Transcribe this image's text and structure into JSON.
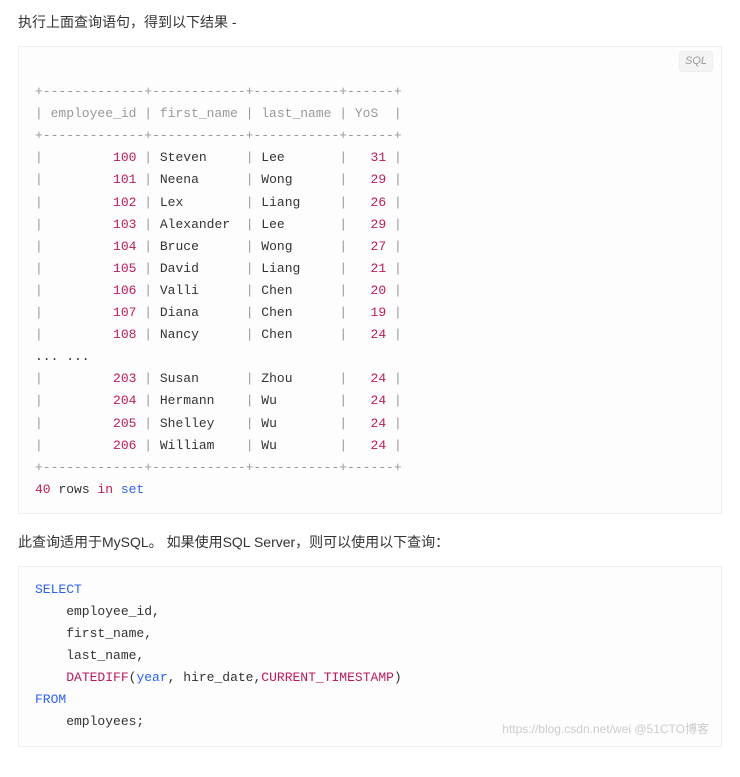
{
  "intro_text": "执行上面查询语句，得到以下结果 -",
  "lang_badge": "SQL",
  "table": {
    "border": "+-------------+------------+-----------+------+",
    "header": "| employee_id | first_name | last_name | YoS  |",
    "rows": [
      {
        "id": "100",
        "fn": "Steven",
        "ln": "Lee",
        "yos": "31"
      },
      {
        "id": "101",
        "fn": "Neena",
        "ln": "Wong",
        "yos": "29"
      },
      {
        "id": "102",
        "fn": "Lex",
        "ln": "Liang",
        "yos": "26"
      },
      {
        "id": "103",
        "fn": "Alexander",
        "ln": "Lee",
        "yos": "29"
      },
      {
        "id": "104",
        "fn": "Bruce",
        "ln": "Wong",
        "yos": "27"
      },
      {
        "id": "105",
        "fn": "David",
        "ln": "Liang",
        "yos": "21"
      },
      {
        "id": "106",
        "fn": "Valli",
        "ln": "Chen",
        "yos": "20"
      },
      {
        "id": "107",
        "fn": "Diana",
        "ln": "Chen",
        "yos": "19"
      },
      {
        "id": "108",
        "fn": "Nancy",
        "ln": "Chen",
        "yos": "24"
      }
    ],
    "ellipsis": "... ...",
    "rows2": [
      {
        "id": "203",
        "fn": "Susan",
        "ln": "Zhou",
        "yos": "24"
      },
      {
        "id": "204",
        "fn": "Hermann",
        "ln": "Wu",
        "yos": "24"
      },
      {
        "id": "205",
        "fn": "Shelley",
        "ln": "Wu",
        "yos": "24"
      },
      {
        "id": "206",
        "fn": "William",
        "ln": "Wu",
        "yos": "24"
      }
    ],
    "footer_count": "40",
    "footer_rows": " rows ",
    "footer_in": "in",
    "footer_set": " set"
  },
  "middle_text": "此查询适用于MySQL。 如果使用SQL Server，则可以使用以下查询：",
  "sql2": {
    "select": "SELECT",
    "col1": "    employee_id,",
    "col2": "    first_name,",
    "col3": "    last_name,",
    "indent": "    ",
    "fn": "DATEDIFF",
    "args_open": "(",
    "arg1": "year",
    "args_mid": ", hire_date,",
    "arg3": "CURRENT_TIMESTAMP",
    "args_close": ")",
    "from": "FROM",
    "table": "    employees;"
  },
  "watermark": "https://blog.csdn.net/wei  @51CTO博客"
}
